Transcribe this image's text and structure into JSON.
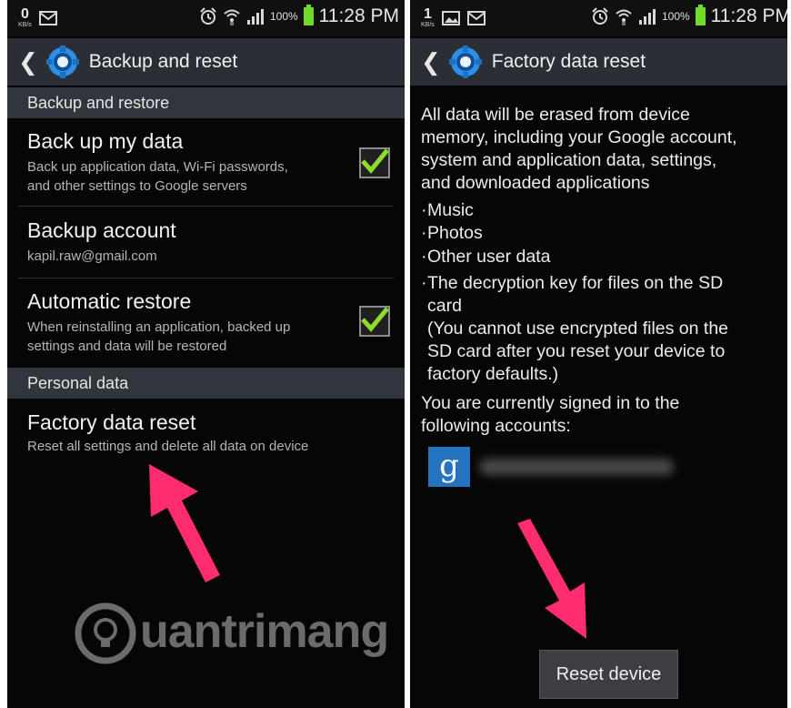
{
  "left_screen": {
    "status": {
      "kbs_value": "0",
      "kbs_unit": "KB/s",
      "battery_pct": "100%",
      "time": "11:28 PM"
    },
    "action_bar": {
      "title": "Backup and reset"
    },
    "sections": {
      "backup_restore": "Backup and restore",
      "personal_data": "Personal data"
    },
    "items": {
      "backup_data": {
        "title": "Back up my data",
        "line1": "Back up application data, Wi-Fi passwords,",
        "line2": "and other settings to Google servers",
        "checked": true
      },
      "backup_account": {
        "title": "Backup account",
        "subtitle": "kapil.raw@gmail.com"
      },
      "auto_restore": {
        "title": "Automatic restore",
        "line1": "When reinstalling an application, backed up",
        "line2": "settings and data will be restored",
        "checked": true
      },
      "factory_reset": {
        "title": "Factory data reset",
        "subtitle": "Reset all settings and delete all data on device"
      }
    },
    "watermark": "uantrimang"
  },
  "right_screen": {
    "status": {
      "kbs_value": "1",
      "kbs_unit": "KB/s",
      "battery_pct": "100%",
      "time": "11:28 PM"
    },
    "action_bar": {
      "title": "Factory data reset"
    },
    "body": {
      "intro": [
        "All data will be erased from device",
        "memory, including your Google account,",
        "system and application data, settings,",
        "and downloaded applications"
      ],
      "bullets": [
        "Music",
        "Photos",
        "Other user data"
      ],
      "sd_bullet": [
        "The decryption key for files on the SD",
        "card",
        "(You cannot use encrypted files on the",
        "SD card after you reset your device to",
        "factory defaults.)"
      ],
      "signed_in": [
        "You are currently signed in to the",
        "following accounts:"
      ]
    },
    "account_icon": "g",
    "reset_button": "Reset device"
  },
  "colors": {
    "accent_check": "#8fdc2a",
    "arrow": "#ff2d6f",
    "google_blue": "#2473c1"
  }
}
